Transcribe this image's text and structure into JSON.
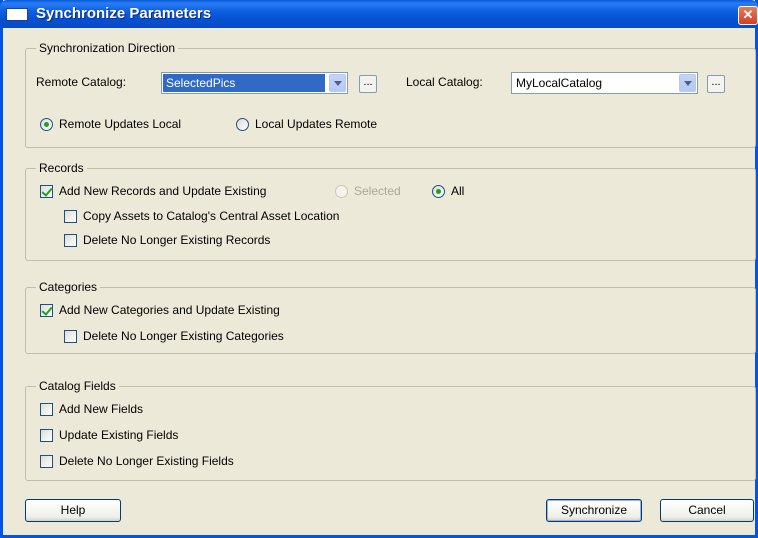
{
  "window": {
    "title": "Synchronize Parameters",
    "close_glyph": "✕"
  },
  "direction": {
    "legend": "Synchronization Direction",
    "remote_label": "Remote Catalog:",
    "remote_value": "SelectedPics",
    "local_label": "Local Catalog:",
    "local_value": "MyLocalCatalog",
    "browse_glyph": "...",
    "options": [
      {
        "label": "Remote Updates Local",
        "selected": true
      },
      {
        "label": "Local Updates Remote",
        "selected": false
      }
    ]
  },
  "records": {
    "legend": "Records",
    "add_update": {
      "label": "Add New Records and Update Existing",
      "checked": true
    },
    "scope_selected": {
      "label": "Selected",
      "selected": false,
      "enabled": false
    },
    "scope_all": {
      "label": "All",
      "selected": true
    },
    "copy_assets": {
      "label": "Copy Assets to Catalog's Central Asset Location",
      "checked": false
    },
    "delete": {
      "label": "Delete No Longer Existing Records",
      "checked": false
    }
  },
  "categories": {
    "legend": "Categories",
    "add_update": {
      "label": "Add New Categories and Update Existing",
      "checked": true
    },
    "delete": {
      "label": "Delete No Longer Existing Categories",
      "checked": false
    }
  },
  "fields": {
    "legend": "Catalog Fields",
    "add_new": {
      "label": "Add New Fields",
      "checked": false
    },
    "update": {
      "label": "Update Existing Fields",
      "checked": false
    },
    "delete": {
      "label": "Delete No Longer Existing Fields",
      "checked": false
    }
  },
  "buttons": {
    "help": "Help",
    "synchronize": "Synchronize",
    "cancel": "Cancel"
  },
  "colors": {
    "title_bar": "#0a5ad8",
    "dialog_bg": "#ece9d8",
    "selection": "#316ac5",
    "check_mark": "#21a121"
  }
}
